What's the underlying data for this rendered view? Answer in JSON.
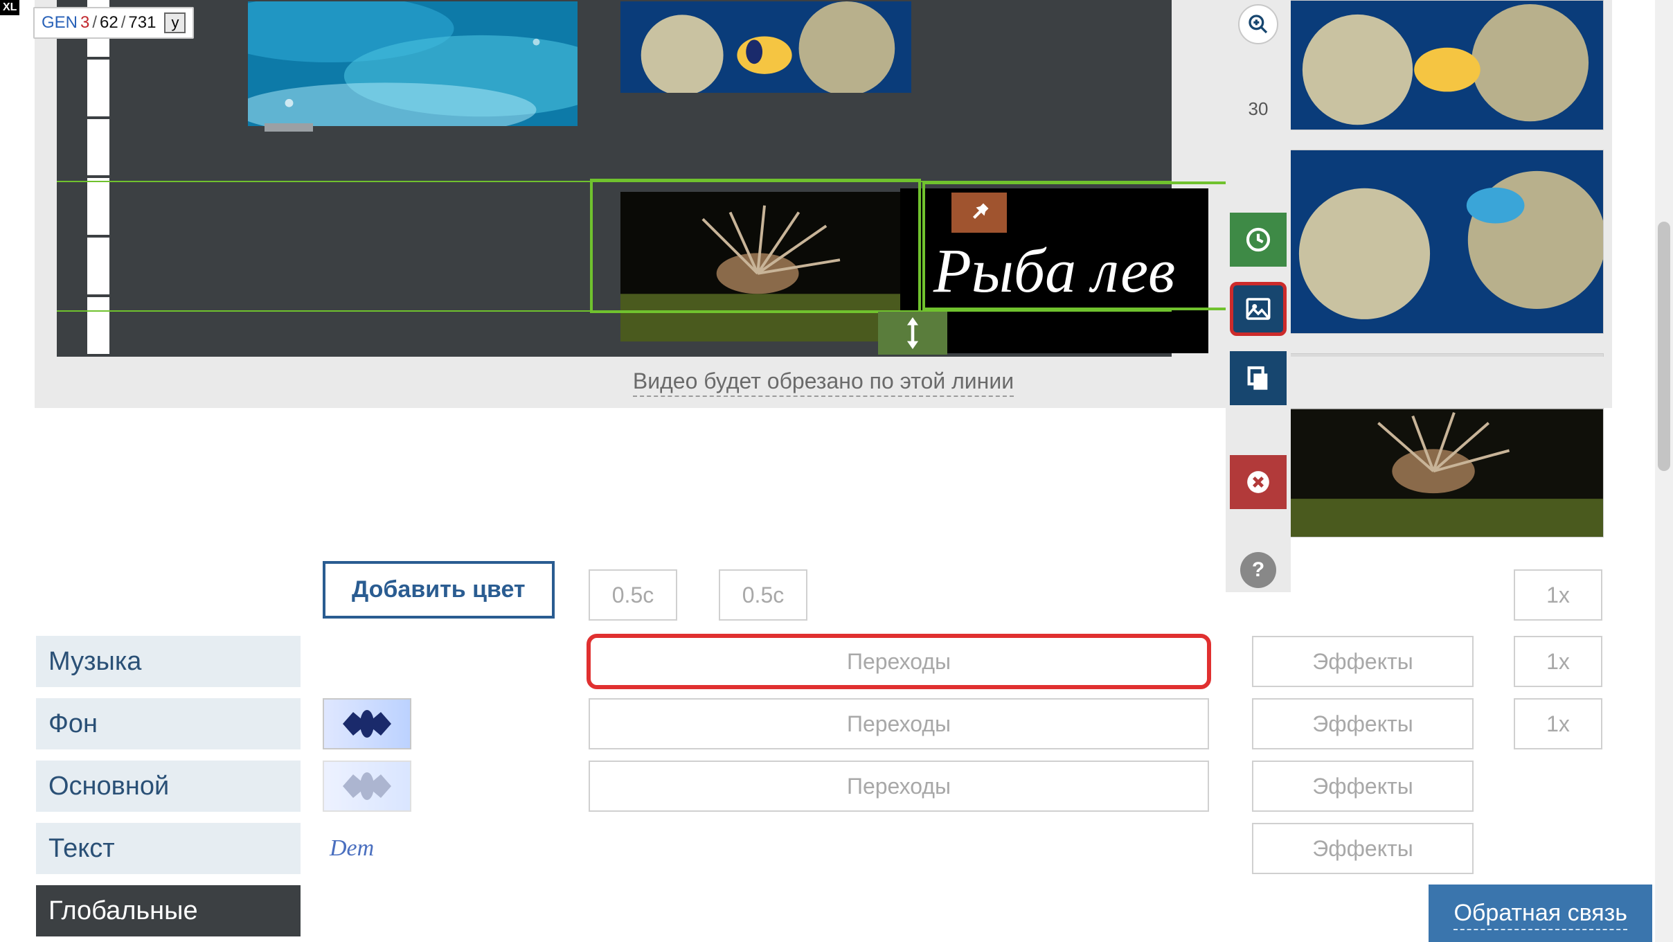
{
  "badge": {
    "xl": "XL"
  },
  "gen": {
    "label": "GEN",
    "n1": "3",
    "n2": "62",
    "n3": "731",
    "slash": "/",
    "y": "y"
  },
  "title_text": "Рыба лев",
  "crop_notice": "Видео будет обрезано по этой линии",
  "zoom_value": "30",
  "add_color": "Добавить цвет",
  "layers": {
    "music": "Музыка",
    "bg": "Фон",
    "main": "Основной",
    "text": "Текст",
    "global": "Глобальные"
  },
  "swatch_text": "Dem",
  "durations": {
    "a": "0.5с",
    "b": "0.5с"
  },
  "transitions": "Переходы",
  "effects": "Эффекты",
  "speed": "1x",
  "feedback": "Обратная связь"
}
